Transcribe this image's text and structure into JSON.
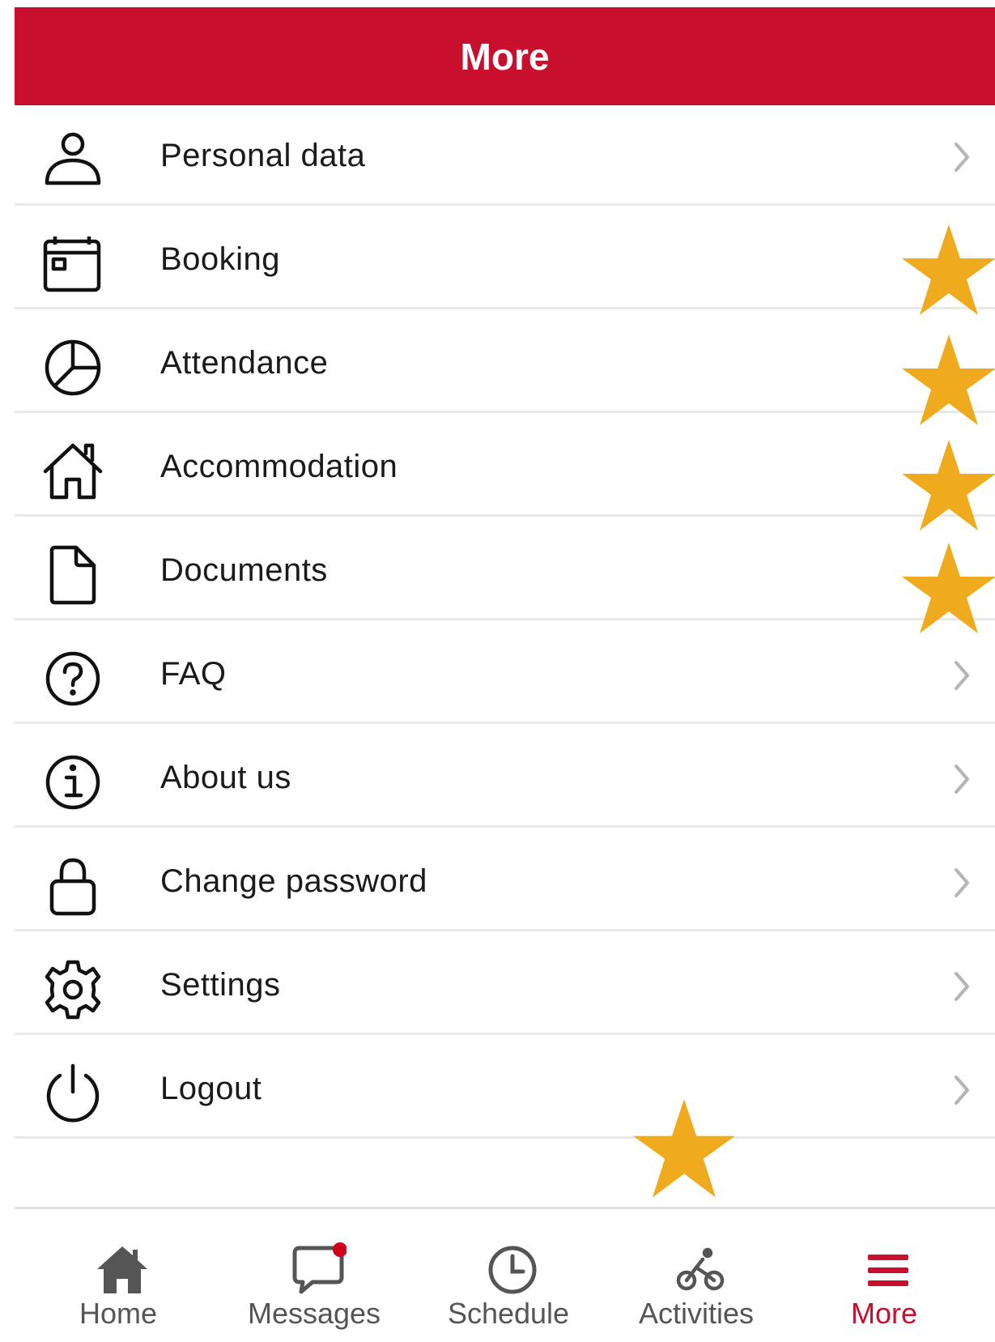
{
  "header": {
    "title": "More"
  },
  "colors": {
    "brand": "#c8102e",
    "star": "#f0aa1e",
    "notification_dot": "#d0021b",
    "chevron": "#b5b5b5"
  },
  "menu": {
    "items": [
      {
        "label": "Personal data",
        "icon": "person-icon",
        "has_chevron": true,
        "starred": false
      },
      {
        "label": "Booking",
        "icon": "calendar-icon",
        "has_chevron": false,
        "starred": true
      },
      {
        "label": "Attendance",
        "icon": "pie-chart-icon",
        "has_chevron": false,
        "starred": true
      },
      {
        "label": "Accommodation",
        "icon": "house-icon",
        "has_chevron": false,
        "starred": true
      },
      {
        "label": "Documents",
        "icon": "document-icon",
        "has_chevron": false,
        "starred": true
      },
      {
        "label": "FAQ",
        "icon": "question-circle-icon",
        "has_chevron": true,
        "starred": false
      },
      {
        "label": "About us",
        "icon": "info-circle-icon",
        "has_chevron": true,
        "starred": false
      },
      {
        "label": "Change password",
        "icon": "lock-icon",
        "has_chevron": true,
        "starred": false
      },
      {
        "label": "Settings",
        "icon": "gear-icon",
        "has_chevron": true,
        "starred": false
      },
      {
        "label": "Logout",
        "icon": "power-icon",
        "has_chevron": true,
        "starred": false
      }
    ]
  },
  "tabbar": {
    "tabs": [
      {
        "label": "Home",
        "icon": "home-icon",
        "active": false
      },
      {
        "label": "Messages",
        "icon": "chat-bubble-icon",
        "active": false,
        "has_notification": true
      },
      {
        "label": "Schedule",
        "icon": "clock-icon",
        "active": false
      },
      {
        "label": "Activities",
        "icon": "bicycle-icon",
        "active": false,
        "starred": true
      },
      {
        "label": "More",
        "icon": "hamburger-menu-icon",
        "active": true
      }
    ]
  }
}
